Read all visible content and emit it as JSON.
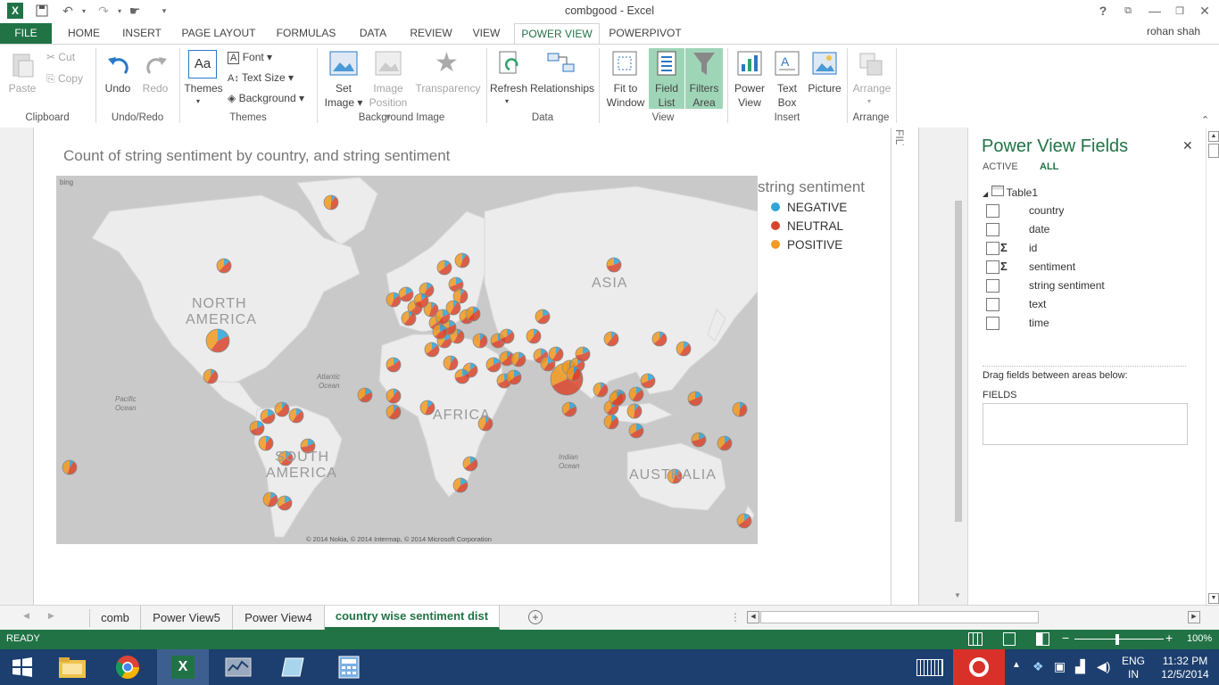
{
  "window": {
    "title": "combgood - Excel",
    "user": "rohan shah",
    "help": "?"
  },
  "tabs": [
    "FILE",
    "HOME",
    "INSERT",
    "PAGE LAYOUT",
    "FORMULAS",
    "DATA",
    "REVIEW",
    "VIEW",
    "POWER VIEW",
    "POWERPIVOT"
  ],
  "ribbon": {
    "clipboard": {
      "paste": "Paste",
      "cut": "Cut",
      "copy": "Copy",
      "group": "Clipboard"
    },
    "undoredo": {
      "undo": "Undo",
      "redo": "Redo",
      "group": "Undo/Redo"
    },
    "themes": {
      "themes": "Themes",
      "font": "Font",
      "textsize": "Text Size",
      "background": "Background",
      "group": "Themes"
    },
    "bgimage": {
      "set": "Set",
      "set2": "Image",
      "pos": "Image",
      "pos2": "Position",
      "transparency": "Transparency",
      "group": "Background Image"
    },
    "data": {
      "refresh": "Refresh",
      "relationships": "Relationships",
      "group": "Data"
    },
    "view": {
      "fit": "Fit to",
      "fit2": "Window",
      "field": "Field",
      "field2": "List",
      "filters": "Filters",
      "filters2": "Area",
      "group": "View"
    },
    "insert": {
      "pv": "Power",
      "pv2": "View",
      "tb": "Text",
      "tb2": "Box",
      "pic": "Picture",
      "group": "Insert"
    },
    "arrange": {
      "arrange": "Arrange",
      "group": "Arrange"
    }
  },
  "report": {
    "title": "Count of string sentiment by country, and string sentiment",
    "legend_title": "string sentiment",
    "legend": [
      {
        "label": "NEGATIVE",
        "color": "#2ea4d8"
      },
      {
        "label": "NEUTRAL",
        "color": "#d9452b"
      },
      {
        "label": "POSITIVE",
        "color": "#f29a1f"
      }
    ],
    "map_labels": {
      "na1": "NORTH",
      "na2": "AMERICA",
      "asia": "ASIA",
      "africa": "AFRICA",
      "sa1": "SOUTH",
      "sa2": "AMERICA",
      "aus": "AUSTRALIA",
      "pac1": "Pacific",
      "pac2": "Ocean",
      "atl1": "Atlantic",
      "atl2": "Ocean",
      "ind1": "Indian",
      "ind2": "Ocean",
      "bing": "bing",
      "copyright": "© 2014 Nokia, © 2014 Intermap, © 2014 Microsoft Corporation"
    },
    "filters_label": "FILTERS"
  },
  "fields_pane": {
    "title": "Power View Fields",
    "tab_active": "ACTIVE",
    "tab_all": "ALL",
    "table": "Table1",
    "fields": [
      {
        "name": "country",
        "sigma": false
      },
      {
        "name": "date",
        "sigma": false
      },
      {
        "name": "id",
        "sigma": true
      },
      {
        "name": "sentiment",
        "sigma": true
      },
      {
        "name": "string sentiment",
        "sigma": false
      },
      {
        "name": "text",
        "sigma": false
      },
      {
        "name": "time",
        "sigma": false
      }
    ],
    "drag_hint": "Drag fields between areas below:",
    "area_label": "FIELDS"
  },
  "sheet_tabs": [
    "comb",
    "Power View5",
    "Power View4",
    "country wise sentiment dist"
  ],
  "active_sheet": "country wise sentiment dist",
  "status": {
    "ready": "READY",
    "zoom": "100%"
  },
  "taskbar": {
    "lang1": "ENG",
    "lang2": "IN",
    "time": "11:32 PM",
    "date": "12/5/2014"
  }
}
